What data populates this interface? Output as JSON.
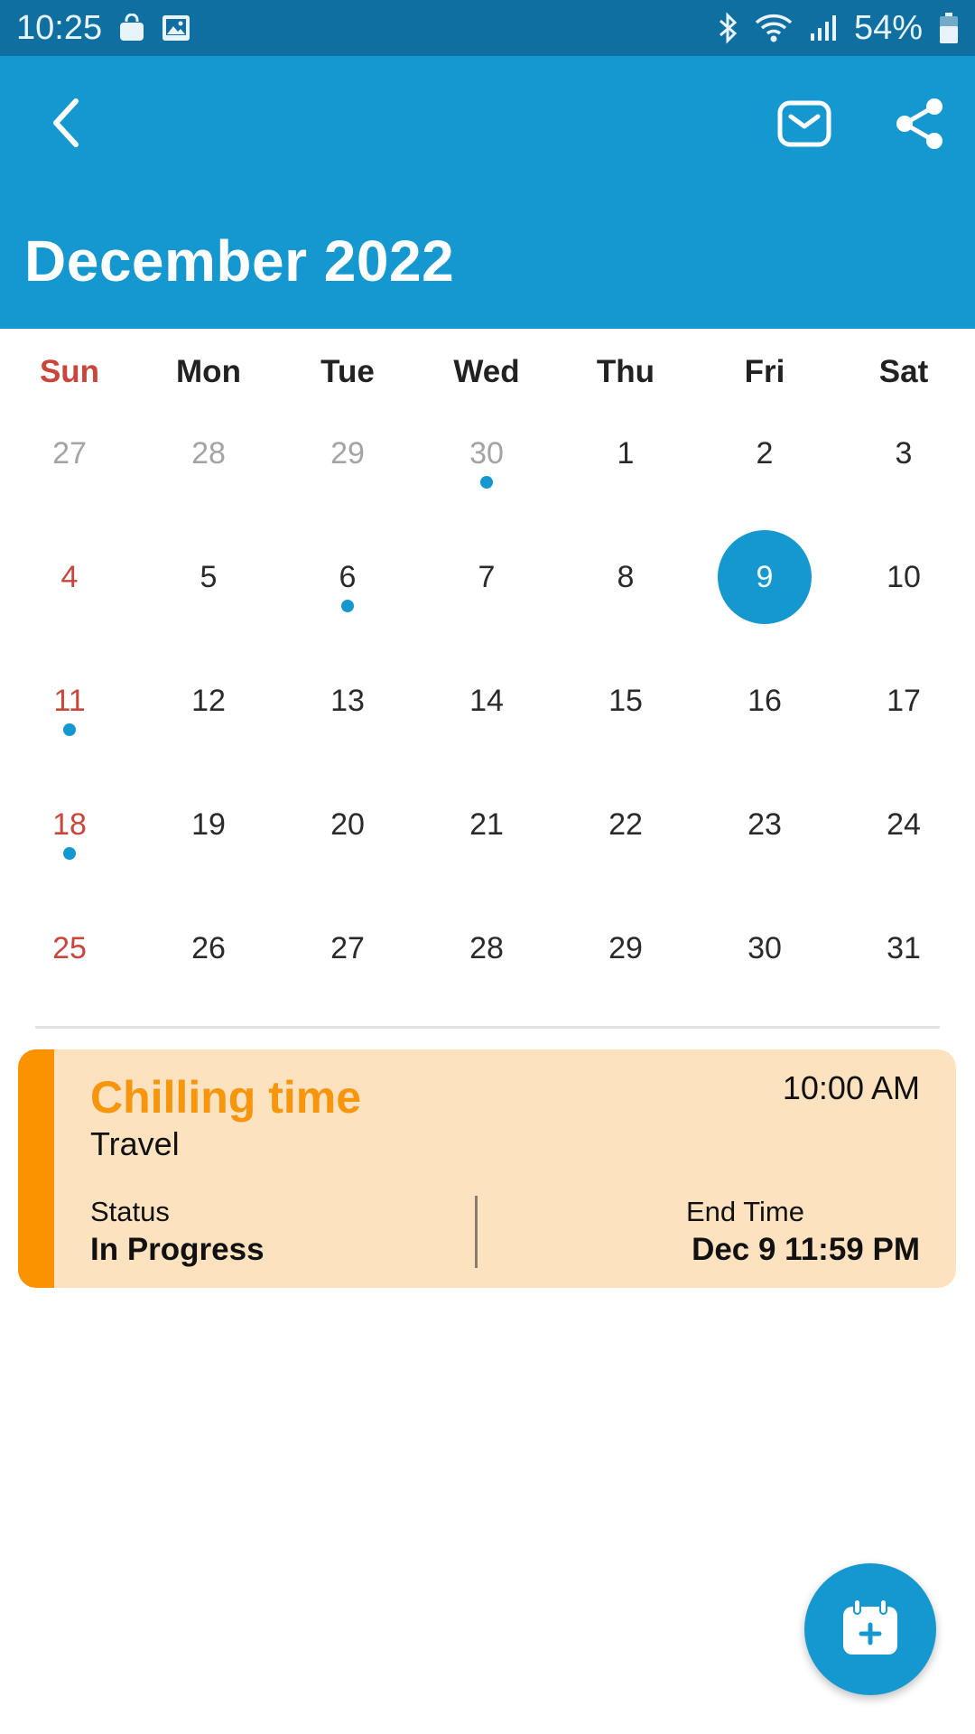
{
  "status_bar": {
    "time": "10:25",
    "battery_percent": "54%",
    "icons_left": [
      "shopping-bag-icon",
      "image-icon"
    ],
    "icons_right": [
      "bluetooth-icon",
      "wifi-icon",
      "signal-icon",
      "battery-icon"
    ]
  },
  "header": {
    "month_title": "December 2022",
    "icons": [
      "back-icon",
      "mail-icon",
      "share-icon"
    ],
    "background": "#1597cf"
  },
  "calendar": {
    "weekdays": [
      "Sun",
      "Mon",
      "Tue",
      "Wed",
      "Thu",
      "Fri",
      "Sat"
    ],
    "weeks": [
      [
        {
          "n": "27",
          "muted": true
        },
        {
          "n": "28",
          "muted": true
        },
        {
          "n": "29",
          "muted": true
        },
        {
          "n": "30",
          "muted": true,
          "dot": true
        },
        {
          "n": "1"
        },
        {
          "n": "2"
        },
        {
          "n": "3"
        }
      ],
      [
        {
          "n": "4"
        },
        {
          "n": "5"
        },
        {
          "n": "6",
          "dot": true
        },
        {
          "n": "7"
        },
        {
          "n": "8"
        },
        {
          "n": "9",
          "selected": true
        },
        {
          "n": "10"
        }
      ],
      [
        {
          "n": "11",
          "dot": true
        },
        {
          "n": "12"
        },
        {
          "n": "13"
        },
        {
          "n": "14"
        },
        {
          "n": "15"
        },
        {
          "n": "16"
        },
        {
          "n": "17"
        }
      ],
      [
        {
          "n": "18",
          "dot": true
        },
        {
          "n": "19"
        },
        {
          "n": "20"
        },
        {
          "n": "21"
        },
        {
          "n": "22"
        },
        {
          "n": "23"
        },
        {
          "n": "24"
        }
      ],
      [
        {
          "n": "25"
        },
        {
          "n": "26"
        },
        {
          "n": "27"
        },
        {
          "n": "28"
        },
        {
          "n": "29"
        },
        {
          "n": "30"
        },
        {
          "n": "31"
        }
      ]
    ],
    "colors": {
      "sunday": "#c8463b",
      "selected": "#1597cf",
      "event_dot": "#1597cf",
      "muted": "#a4a4a4"
    }
  },
  "event": {
    "title": "Chilling time",
    "category": "Travel",
    "time": "10:00 AM",
    "status_label": "Status",
    "status_value": "In Progress",
    "end_label": "End Time",
    "end_value": "Dec 9 11:59 PM",
    "accent_color": "#fb9300",
    "background_color": "#fde2c0"
  },
  "fab": {
    "icon": "calendar-add-icon"
  }
}
